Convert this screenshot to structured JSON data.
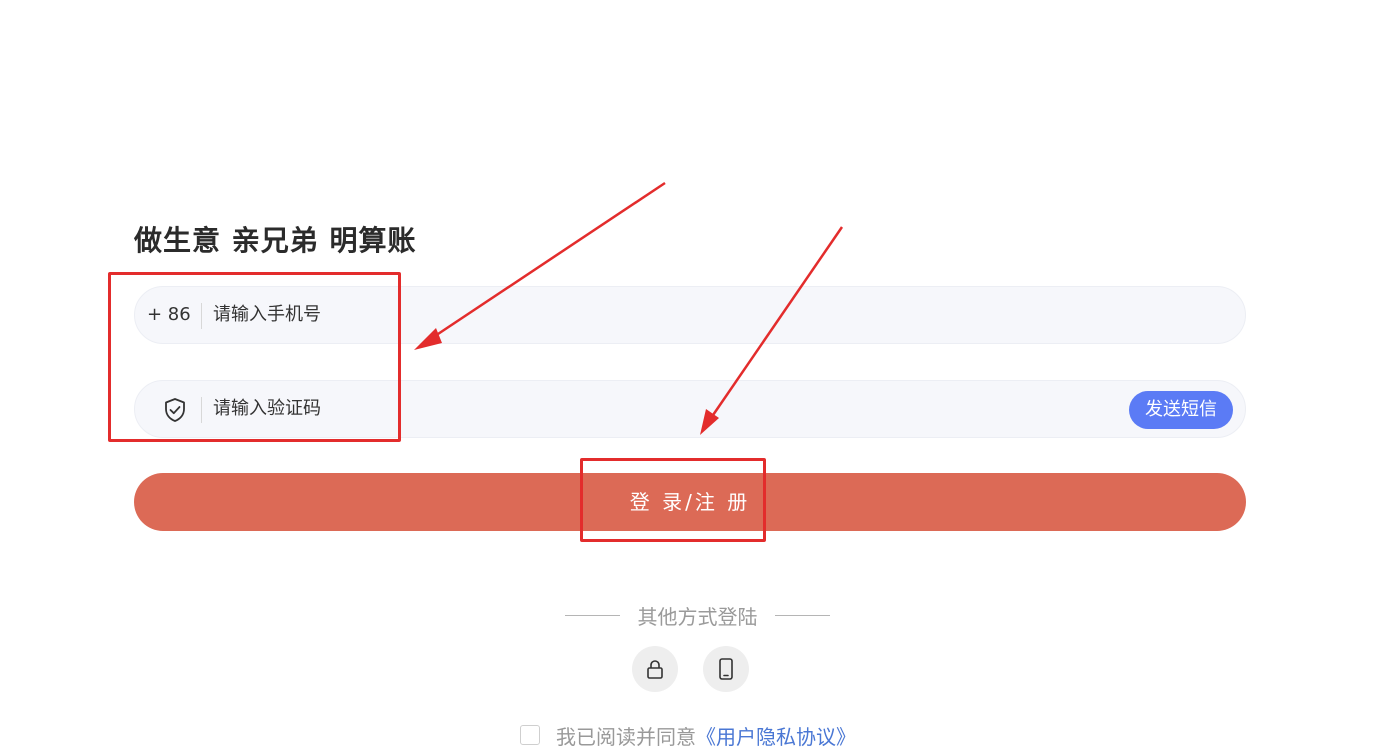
{
  "slogan": "做生意 亲兄弟 明算账",
  "phone_field": {
    "prefix": "+  86",
    "placeholder": "请输入手机号"
  },
  "code_field": {
    "icon": "shield-check-icon",
    "placeholder": "请输入验证码",
    "send_button": "发送短信"
  },
  "login_button": "登 录/注 册",
  "other_login": {
    "label": "其他方式登陆",
    "options": [
      "lock-icon",
      "mobile-phone-icon"
    ]
  },
  "agreement": {
    "text": "我已阅读并同意",
    "link": "《用户隐私协议》"
  },
  "colors": {
    "primary_button": "#dc6a56",
    "send_button": "#5b7bf5",
    "link": "#4a77d4",
    "annotation": "#e32c2c"
  }
}
